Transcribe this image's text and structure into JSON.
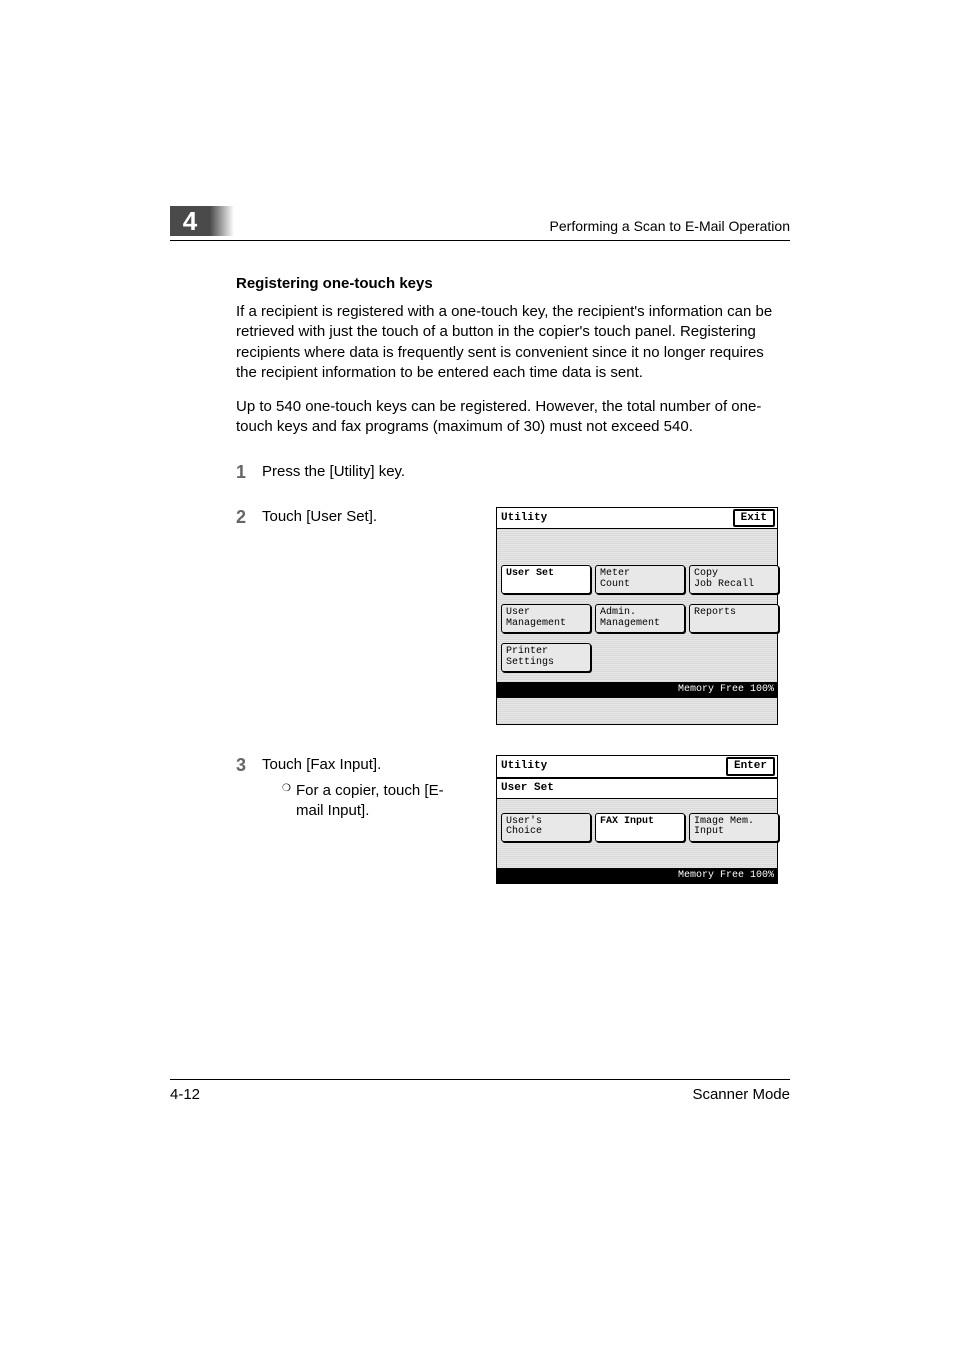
{
  "header": {
    "chapter": "4",
    "title": "Performing a Scan to E-Mail Operation"
  },
  "section": {
    "heading": "Registering one-touch keys",
    "para1": "If a recipient is registered with a one-touch key, the recipient's information can be retrieved with just the touch of a button in the copier's touch panel. Registering recipients where data is frequently sent is convenient since it no longer requires the recipient information to be entered each time data is sent.",
    "para2": "Up to 540 one-touch keys can be registered. However, the total number of one-touch keys and fax programs (maximum of 30) must not exceed 540."
  },
  "steps": {
    "s1": {
      "num": "1",
      "text": "Press the [Utility] key."
    },
    "s2": {
      "num": "2",
      "text": "Touch [User Set]."
    },
    "s3": {
      "num": "3",
      "text": "Touch [Fax Input].",
      "sub": "For a copier, touch [E-mail Input]."
    }
  },
  "panel1": {
    "title": "Utility",
    "action": "Exit",
    "buttons": {
      "r1b1": "User Set",
      "r1b2": "Meter\nCount",
      "r1b3": "Copy\nJob Recall",
      "r2b1": "User\nManagement",
      "r2b2": "Admin.\nManagement",
      "r2b3": "Reports",
      "r3b1": "Printer\nSettings"
    },
    "status": "Memory\nFree 100%"
  },
  "panel2": {
    "title": "Utility",
    "action": "Enter",
    "subtitle": "User Set",
    "buttons": {
      "b1": "User's\nChoice",
      "b2": "FAX Input",
      "b3": "Image Mem.\nInput"
    },
    "status": "Memory\nFree 100%"
  },
  "footer": {
    "page": "4-12",
    "mode": "Scanner Mode"
  }
}
